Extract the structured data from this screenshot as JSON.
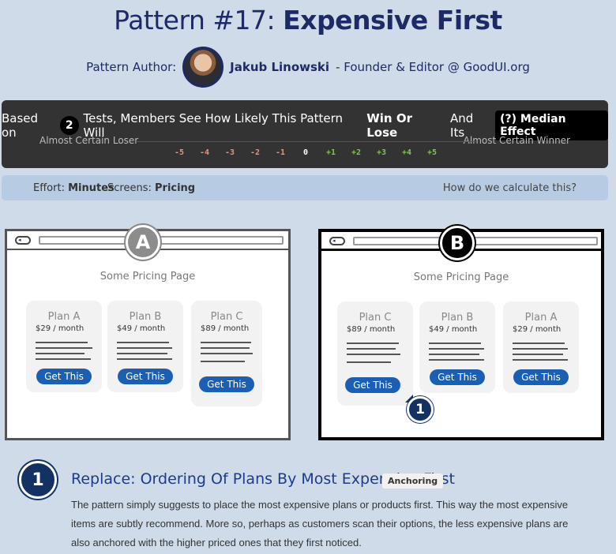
{
  "header": {
    "title_prefix": "Pattern #17: ",
    "title_strong": "Expensive First",
    "author_label": "Pattern Author:",
    "author_name": "Jakub Linowski",
    "author_role": " - Founder & Editor @ GoodUI.org"
  },
  "results": {
    "based_on": "Based on",
    "tests_count": "2",
    "tests_text": "Tests, Members See How Likely This Pattern Will",
    "win_or_lose": "Win Or Lose",
    "and_its": "And Its",
    "median_effect": "(?) Median Effect",
    "left_label": "Almost Certain Loser",
    "right_label": "Almost Certain Winner",
    "ticks": [
      "-5",
      "-4",
      "-3",
      "-2",
      "-1",
      "0",
      "+1",
      "+2",
      "+3",
      "+4",
      "+5"
    ],
    "colors": {
      "negative": "#e8967a",
      "neutral": "#ffffff",
      "positive": "#7ec850"
    }
  },
  "info": {
    "effort_label": "Effort:",
    "effort_value": "Minutes",
    "screens_label": "Screens:",
    "screens_value": "Pricing",
    "how_link": "How do we calculate this?"
  },
  "variant_a": {
    "badge": "A",
    "page_name": "Some Pricing Page",
    "plans": [
      {
        "name": "Plan A",
        "price": "$29 / month",
        "cta": "Get This"
      },
      {
        "name": "Plan B",
        "price": "$49 / month",
        "cta": "Get This"
      },
      {
        "name": "Plan C",
        "price": "$89 / month",
        "cta": "Get This"
      }
    ]
  },
  "variant_b": {
    "badge": "B",
    "page_name": "Some Pricing Page",
    "plans": [
      {
        "name": "Plan C",
        "price": "$89 / month",
        "cta": "Get This"
      },
      {
        "name": "Plan B",
        "price": "$49 / month",
        "cta": "Get This"
      },
      {
        "name": "Plan A",
        "price": "$29 / month",
        "cta": "Get This"
      }
    ],
    "marker": "1"
  },
  "change": {
    "number": "1",
    "title": "Replace: Ordering Of Plans By Most Expensive First",
    "tag": "Anchoring",
    "description": "The pattern simply suggests to place the most expensive plans or products first. This way the most expensive items are subtly recommend. More so, perhaps as customers scan their options, the less expensive plans are also anchored with the higher priced ones that they first noticed."
  },
  "accent": {
    "navy": "#133263",
    "button_blue": "#1a5fb4"
  }
}
